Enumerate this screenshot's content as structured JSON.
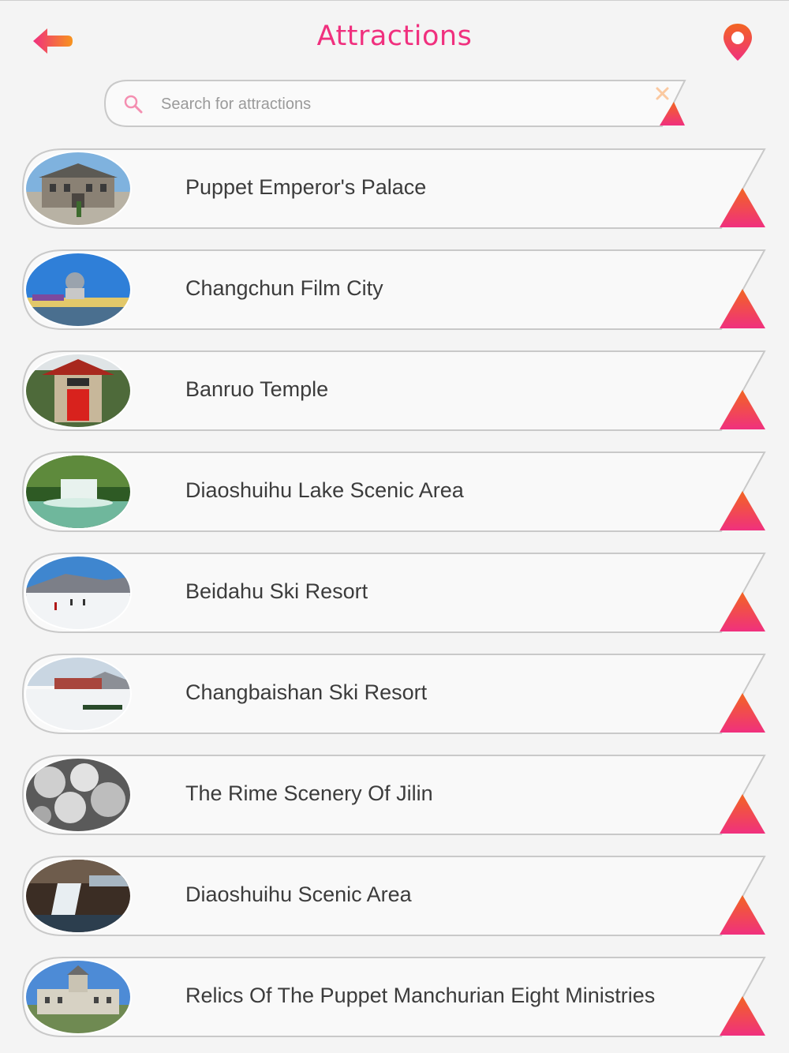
{
  "header": {
    "title": "Attractions",
    "back_icon": "arrow-left-icon",
    "location_icon": "map-pin-icon"
  },
  "search": {
    "placeholder": "Search for attractions",
    "value": ""
  },
  "colors": {
    "accent_pink": "#f0307e",
    "accent_orange": "#f26522",
    "background": "#f4f4f4",
    "text": "#3c3c3c"
  },
  "attractions": [
    {
      "name": "Puppet Emperor's Palace"
    },
    {
      "name": "Changchun Film City"
    },
    {
      "name": "Banruo Temple"
    },
    {
      "name": "Diaoshuihu Lake Scenic Area"
    },
    {
      "name": "Beidahu Ski Resort"
    },
    {
      "name": "Changbaishan Ski Resort"
    },
    {
      "name": "The Rime Scenery Of Jilin"
    },
    {
      "name": "Diaoshuihu Scenic Area"
    },
    {
      "name": "Relics Of The Puppet Manchurian Eight Ministries"
    }
  ]
}
